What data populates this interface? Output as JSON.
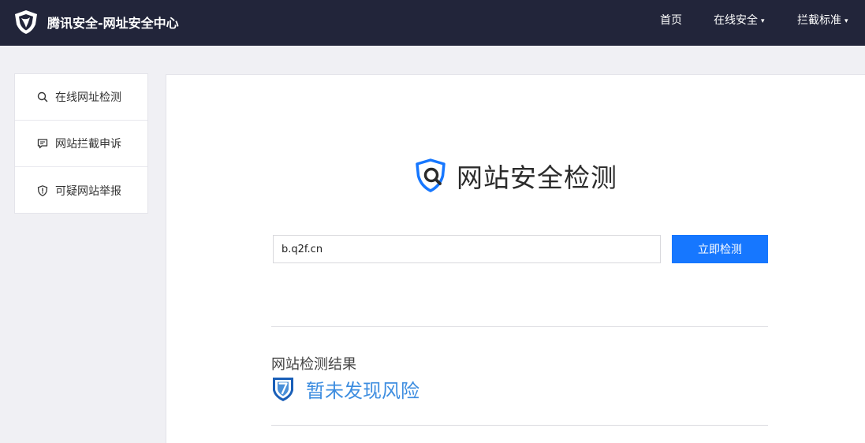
{
  "header": {
    "brand_title": "腾讯安全-网址安全中心",
    "logo_icon": "tencent-security-logo-icon",
    "nav": [
      {
        "label": "首页",
        "has_dropdown": false
      },
      {
        "label": "在线安全",
        "has_dropdown": true
      },
      {
        "label": "拦截标准",
        "has_dropdown": true
      }
    ],
    "caret": "▾"
  },
  "sidebar": {
    "items": [
      {
        "label": "在线网址检测",
        "icon": "search-icon"
      },
      {
        "label": "网站拦截申诉",
        "icon": "chat-bubble-icon"
      },
      {
        "label": "可疑网站举报",
        "icon": "shield-exclamation-icon"
      }
    ]
  },
  "main": {
    "title": "网站安全检测",
    "title_icon": "shield-search-icon",
    "search": {
      "value": "b.q2f.cn",
      "button_label": "立即检测"
    },
    "result": {
      "label": "网站检测结果",
      "status_text": "暂未发现风险",
      "status_icon": "shield-safe-icon"
    }
  },
  "colors": {
    "header_bg": "#22253a",
    "accent": "#1677ff",
    "safe_text": "#3d8de0",
    "page_bg": "#f0f0f4"
  }
}
